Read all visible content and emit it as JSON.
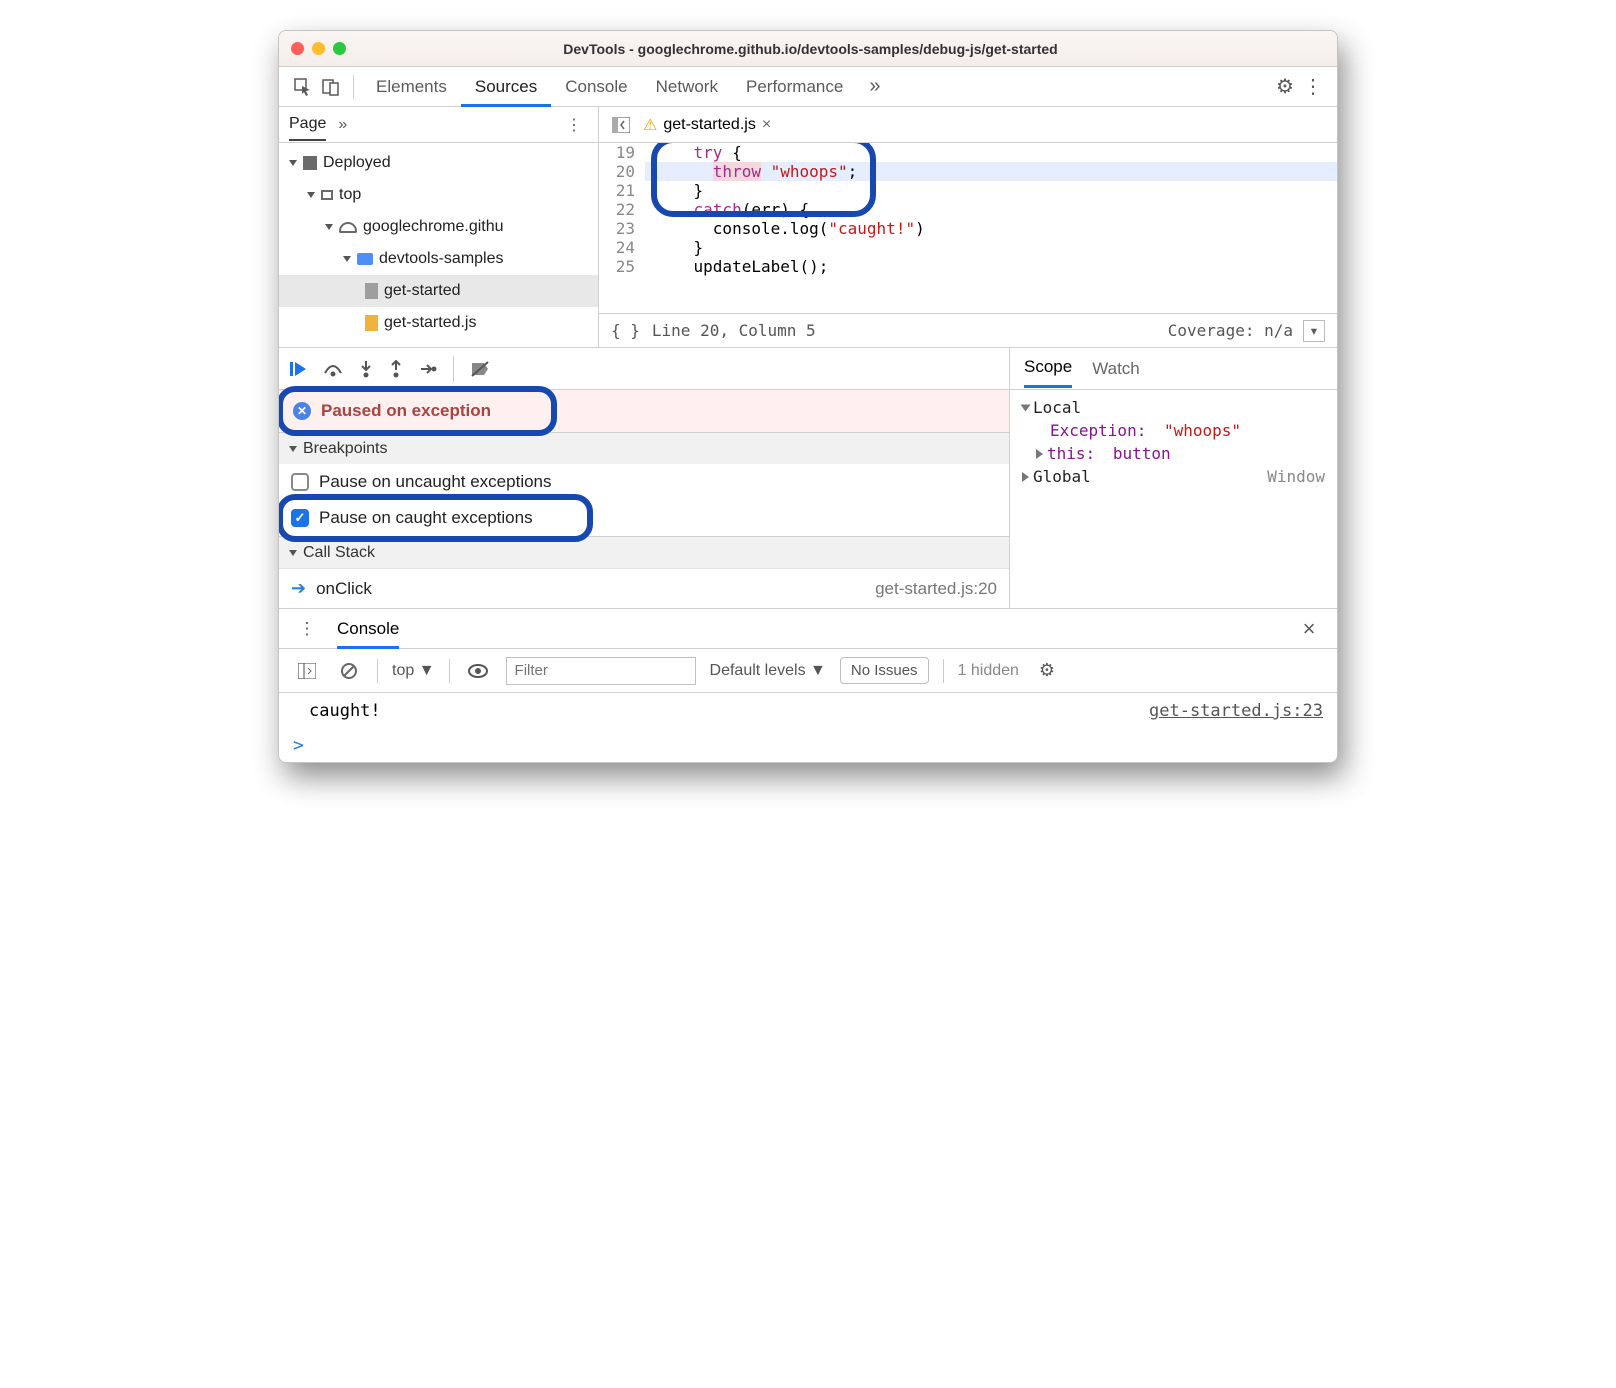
{
  "title": "DevTools - googlechrome.github.io/devtools-samples/debug-js/get-started",
  "tabs": {
    "elements": "Elements",
    "sources": "Sources",
    "console": "Console",
    "network": "Network",
    "performance": "Performance"
  },
  "sidebar": {
    "page": "Page",
    "tree": {
      "deployed": "Deployed",
      "top": "top",
      "host": "googlechrome.githu",
      "folder": "devtools-samples",
      "file_html": "get-started",
      "file_js": "get-started.js"
    }
  },
  "file_tab": "get-started.js",
  "code": {
    "lines": [
      19,
      20,
      21,
      22,
      23,
      24,
      25
    ],
    "l19": "    try {",
    "l20_a": "      ",
    "l20_throw": "throw",
    "l20_sp": " ",
    "l20_str": "\"whoops\"",
    "l20_end": ";",
    "l21": "    }",
    "l22_a": "    ",
    "l22_catch": "catch",
    "l22_b": "(err) {",
    "l23_a": "      console.log(",
    "l23_str": "\"caught!\"",
    "l23_b": ")",
    "l24": "    }",
    "l25": "    updateLabel();"
  },
  "status": {
    "braces": "{ }",
    "pos": "Line 20, Column 5",
    "coverage": "Coverage: n/a"
  },
  "paused": "Paused on exception",
  "sections": {
    "breakpoints": "Breakpoints",
    "callstack": "Call Stack"
  },
  "bp": {
    "uncaught": "Pause on uncaught exceptions",
    "caught": "Pause on caught exceptions"
  },
  "stack": {
    "fn": "onClick",
    "loc": "get-started.js:20"
  },
  "scope": {
    "tabs": {
      "scope": "Scope",
      "watch": "Watch"
    },
    "local": "Local",
    "exception_k": "Exception: ",
    "exception_v": "\"whoops\"",
    "this_k": "this: ",
    "this_v": "button",
    "global": "Global",
    "window": "Window"
  },
  "console": {
    "tab": "Console",
    "top": "top",
    "levels": "Default levels",
    "noissues": "No Issues",
    "hidden": "1 hidden",
    "filter_ph": "Filter",
    "msg": "caught!",
    "msg_loc": "get-started.js:23",
    "prompt": ">"
  }
}
